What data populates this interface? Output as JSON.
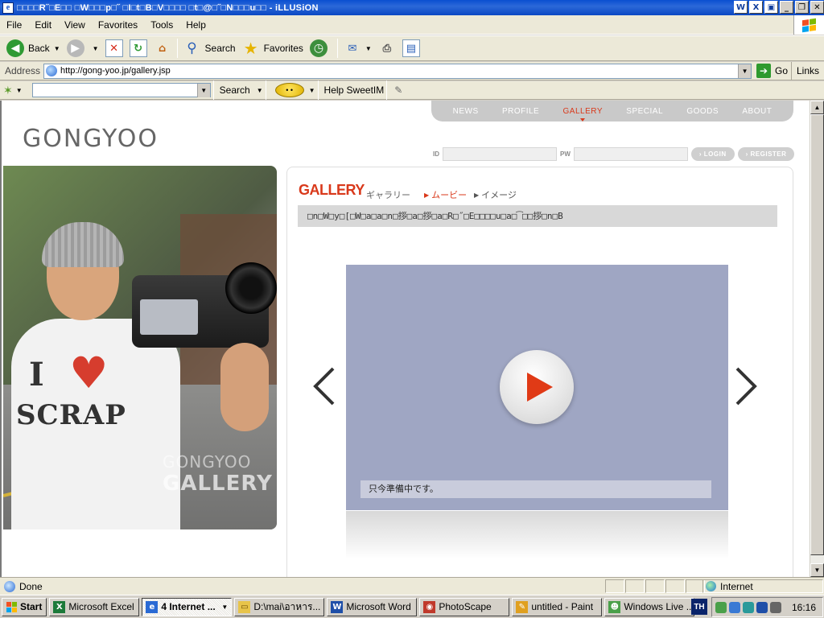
{
  "window": {
    "title": "□□□□R˝□E□□ □W□□□p□˝ □I□t□B□V□□□□ □t□@□˝□N□□□u□□ - iLLUSiON"
  },
  "menubar": {
    "items": [
      "File",
      "Edit",
      "View",
      "Favorites",
      "Tools",
      "Help"
    ]
  },
  "toolbar": {
    "back_label": "Back",
    "search_label": "Search",
    "favorites_label": "Favorites"
  },
  "addressbar": {
    "label": "Address",
    "url": "http://gong-yoo.jp/gallery.jsp",
    "go_label": "Go",
    "links_label": "Links"
  },
  "sweetim": {
    "search_label": "Search",
    "help_label": "Help SweetIM"
  },
  "site": {
    "nav": [
      "NEWS",
      "PROFILE",
      "GALLERY",
      "SPECIAL",
      "GOODS",
      "ABOUT"
    ],
    "active_nav": "GALLERY",
    "logo": "GONGYOO",
    "login": {
      "id_label": "ID",
      "pw_label": "PW",
      "login_button": "LOGIN",
      "register_button": "REGISTER"
    },
    "photo_watermark": {
      "line1": "GONGYOO",
      "line2": "GALLERY"
    },
    "gallery": {
      "title": "GALLERY",
      "subtitle": "ギャラリー",
      "movie_link": "ムービー",
      "image_link": "イメージ",
      "notice": "□n□W□y□[□W□a□a□n□拶□a□拶□a□R□˝□E□□□□u□a□͡□□拶□n□B"
    },
    "video": {
      "caption": "只今準備中です。"
    }
  },
  "statusbar": {
    "status": "Done",
    "zone": "Internet"
  },
  "taskbar": {
    "start_label": "Start",
    "tasks": [
      {
        "label": "Microsoft Excel"
      },
      {
        "label": "4 Internet ..."
      },
      {
        "label": "D:\\mai\\อาหาร..."
      },
      {
        "label": "Microsoft Word"
      },
      {
        "label": "PhotoScape"
      },
      {
        "label": "untitled - Paint"
      },
      {
        "label": "Windows Live ..."
      }
    ],
    "lang": "TH",
    "clock": "16:16"
  },
  "colors": {
    "accent_red": "#d9391b",
    "xp_blue": "#0a4fd0",
    "video_bg": "#9fa6c3"
  }
}
